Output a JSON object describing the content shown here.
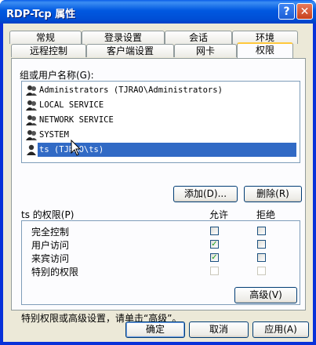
{
  "window": {
    "title": "RDP-Tcp 属性",
    "help": "?",
    "close": "✕"
  },
  "tabs_row1": [
    "常规",
    "登录设置",
    "会话",
    "环境"
  ],
  "tabs_row2": [
    "远程控制",
    "客户端设置",
    "网卡",
    "权限"
  ],
  "active_tab": "权限",
  "users_label": "组或用户名称(G):",
  "users": [
    {
      "name": "Administrators (TJRAO\\Administrators)",
      "icon": "group-icon"
    },
    {
      "name": "LOCAL SERVICE",
      "icon": "group-icon"
    },
    {
      "name": "NETWORK SERVICE",
      "icon": "group-icon"
    },
    {
      "name": "SYSTEM",
      "icon": "group-icon"
    },
    {
      "name": "ts (TJRAO\\ts)",
      "icon": "user-icon",
      "selected": true
    }
  ],
  "add_button": "添加(D)...",
  "remove_button": "删除(R)",
  "perm_label": "ts 的权限(P)",
  "allow_header": "允许",
  "deny_header": "拒绝",
  "permissions": [
    {
      "name": "完全控制",
      "allow": false,
      "deny": false,
      "disabled": false
    },
    {
      "name": "用户访问",
      "allow": true,
      "deny": false,
      "disabled": false
    },
    {
      "name": "来宾访问",
      "allow": true,
      "deny": false,
      "disabled": false
    },
    {
      "name": "特别的权限",
      "allow": false,
      "deny": false,
      "disabled": true
    }
  ],
  "advanced_hint": "特别权限或高级设置，请单击“高级”。",
  "advanced_button": "高级(V)",
  "ok_button": "确定",
  "cancel_button": "取消",
  "apply_button": "应用(A)",
  "colors": {
    "title_bar": "#0058e0",
    "selection": "#316ac5",
    "check": "#21a121",
    "face": "#ece9d8"
  }
}
